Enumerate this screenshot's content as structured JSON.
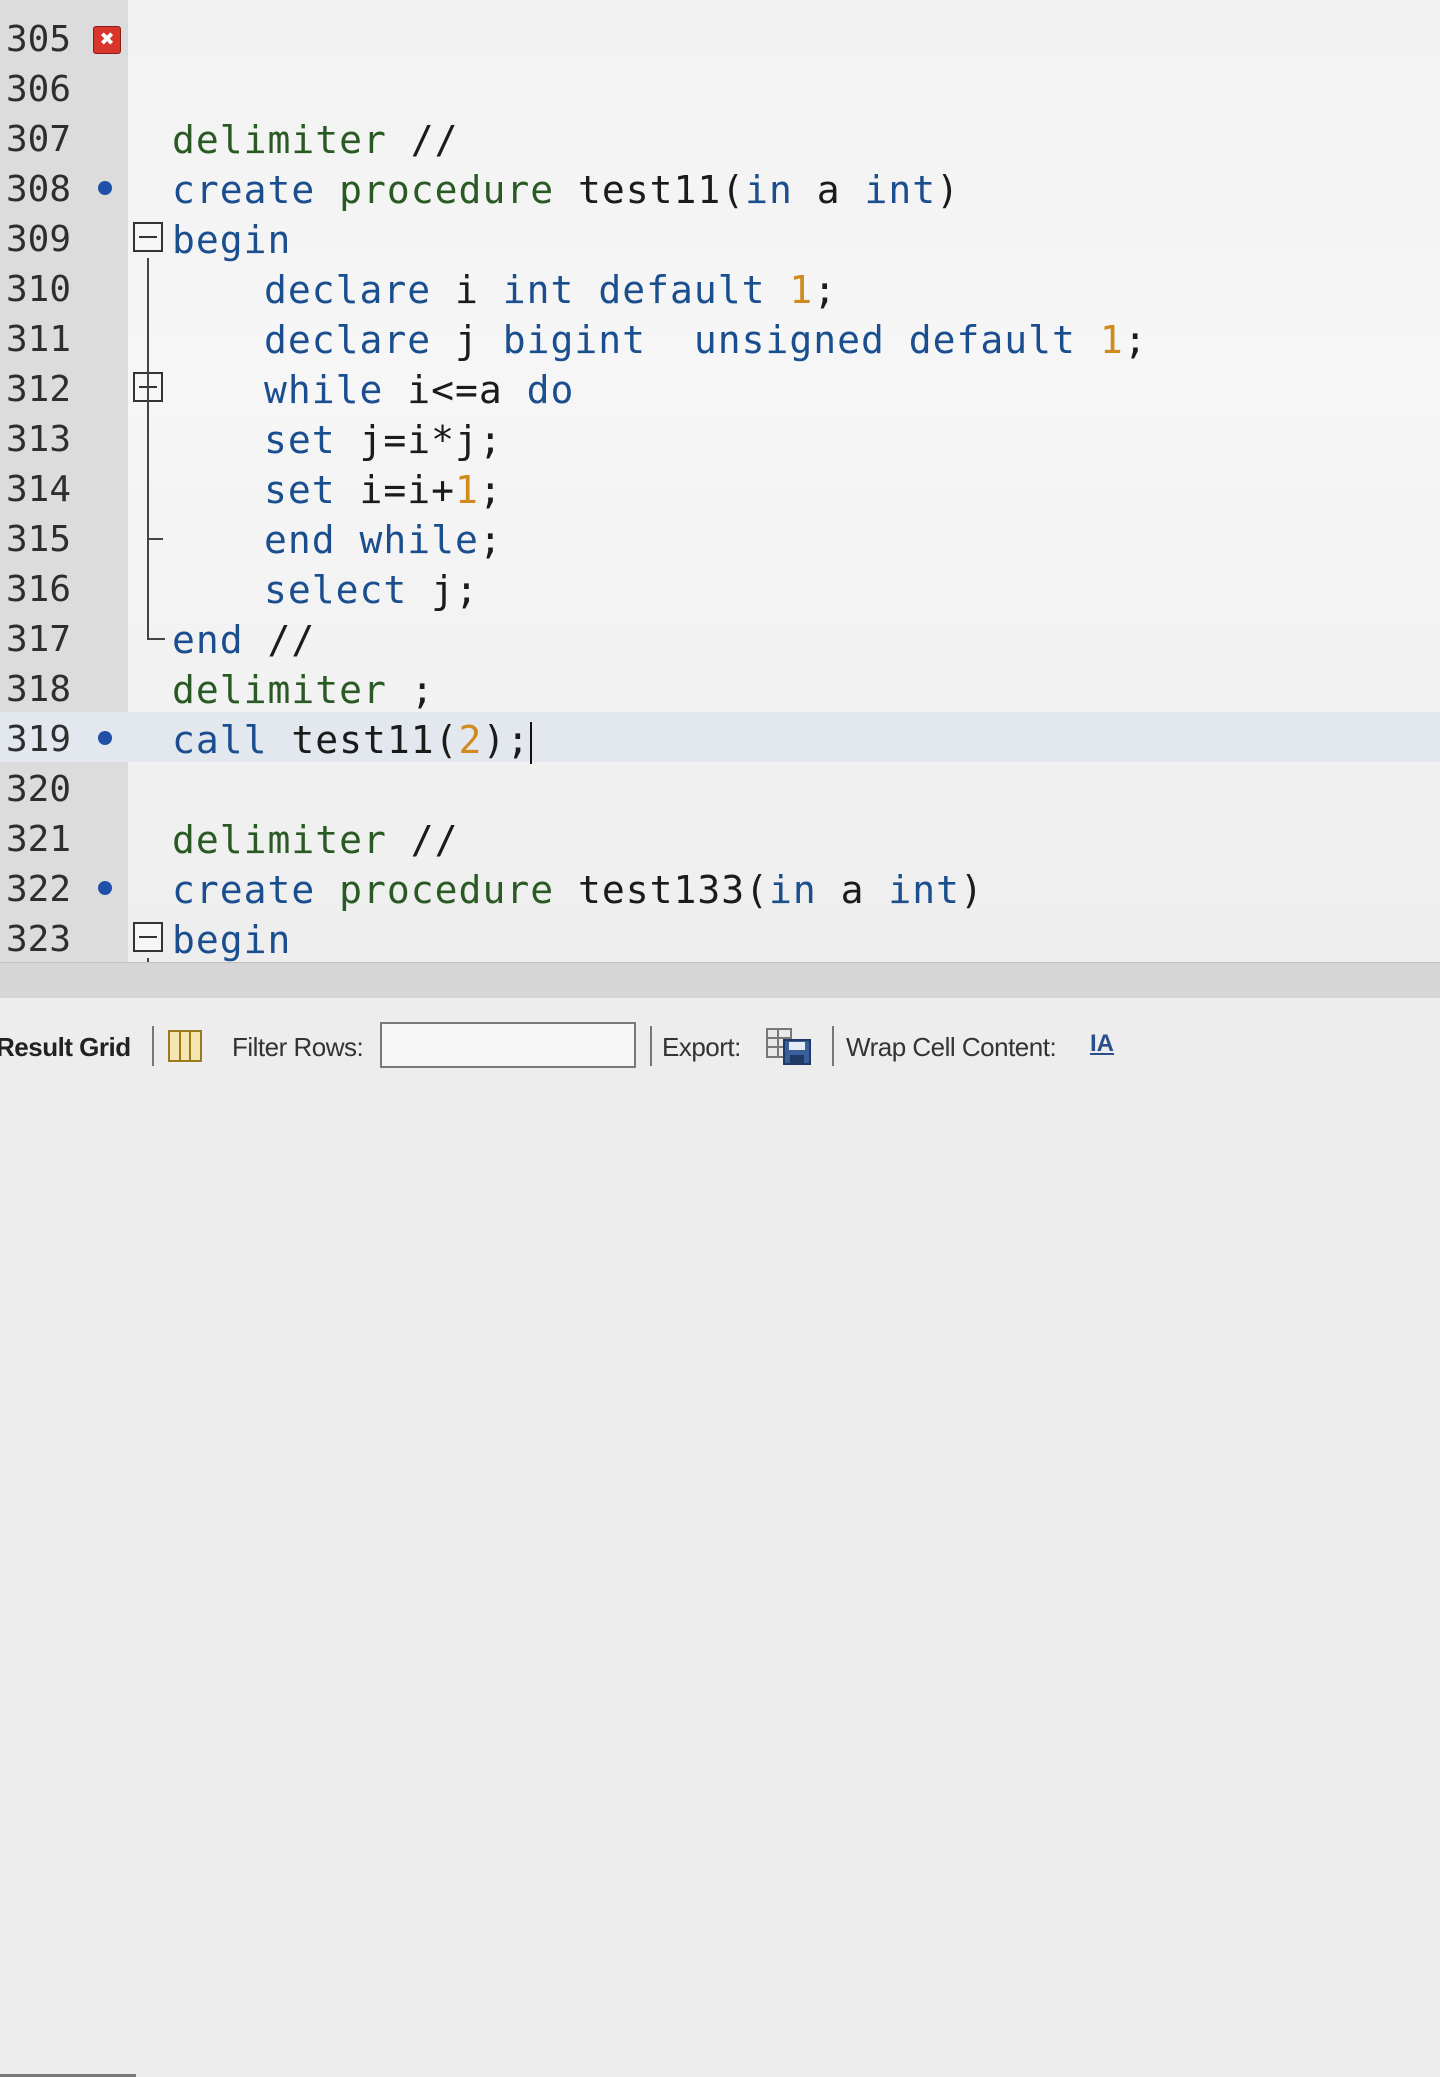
{
  "editor": {
    "lines": [
      {
        "num": "305",
        "marker": "error",
        "fold": "",
        "indent": 0,
        "tokens": []
      },
      {
        "num": "306",
        "marker": "",
        "fold": "",
        "indent": 0,
        "tokens": []
      },
      {
        "num": "307",
        "marker": "",
        "fold": "",
        "indent": 0,
        "tokens": [
          {
            "t": "delimiter",
            "c": "kw2"
          },
          {
            "t": " //",
            "c": ""
          }
        ]
      },
      {
        "num": "308",
        "marker": "dot",
        "fold": "",
        "indent": 0,
        "tokens": [
          {
            "t": "create",
            "c": "kw"
          },
          {
            "t": " ",
            "c": ""
          },
          {
            "t": "procedure",
            "c": "kw2"
          },
          {
            "t": " test11(",
            "c": ""
          },
          {
            "t": "in",
            "c": "kw"
          },
          {
            "t": " a ",
            "c": ""
          },
          {
            "t": "int",
            "c": "kw"
          },
          {
            "t": ")",
            "c": ""
          }
        ]
      },
      {
        "num": "309",
        "marker": "",
        "fold": "open",
        "indent": 0,
        "tokens": [
          {
            "t": "begin",
            "c": "kw"
          }
        ]
      },
      {
        "num": "310",
        "marker": "",
        "fold": "",
        "indent": 1,
        "tokens": [
          {
            "t": "declare",
            "c": "kw"
          },
          {
            "t": " i ",
            "c": ""
          },
          {
            "t": "int",
            "c": "kw"
          },
          {
            "t": " ",
            "c": ""
          },
          {
            "t": "default",
            "c": "kw"
          },
          {
            "t": " ",
            "c": ""
          },
          {
            "t": "1",
            "c": "num"
          },
          {
            "t": ";",
            "c": ""
          }
        ]
      },
      {
        "num": "311",
        "marker": "",
        "fold": "",
        "indent": 1,
        "tokens": [
          {
            "t": "declare",
            "c": "kw"
          },
          {
            "t": " j ",
            "c": ""
          },
          {
            "t": "bigint",
            "c": "kw"
          },
          {
            "t": "  ",
            "c": ""
          },
          {
            "t": "unsigned",
            "c": "kw"
          },
          {
            "t": " ",
            "c": ""
          },
          {
            "t": "default",
            "c": "kw"
          },
          {
            "t": " ",
            "c": ""
          },
          {
            "t": "1",
            "c": "num"
          },
          {
            "t": ";",
            "c": ""
          }
        ]
      },
      {
        "num": "312",
        "marker": "",
        "fold": "open",
        "indent": 1,
        "tokens": [
          {
            "t": "while",
            "c": "kw"
          },
          {
            "t": " i<=a ",
            "c": ""
          },
          {
            "t": "do",
            "c": "kw"
          }
        ]
      },
      {
        "num": "313",
        "marker": "",
        "fold": "",
        "indent": 1,
        "tokens": [
          {
            "t": "set",
            "c": "kw"
          },
          {
            "t": " j=i*j;",
            "c": ""
          }
        ]
      },
      {
        "num": "314",
        "marker": "",
        "fold": "",
        "indent": 1,
        "tokens": [
          {
            "t": "set",
            "c": "kw"
          },
          {
            "t": " i=i+",
            "c": ""
          },
          {
            "t": "1",
            "c": "num"
          },
          {
            "t": ";",
            "c": ""
          }
        ]
      },
      {
        "num": "315",
        "marker": "",
        "fold": "",
        "indent": 1,
        "tokens": [
          {
            "t": "end",
            "c": "kw"
          },
          {
            "t": " ",
            "c": ""
          },
          {
            "t": "while",
            "c": "kw"
          },
          {
            "t": ";",
            "c": ""
          }
        ]
      },
      {
        "num": "316",
        "marker": "",
        "fold": "",
        "indent": 1,
        "tokens": [
          {
            "t": "select",
            "c": "kw"
          },
          {
            "t": " j;",
            "c": ""
          }
        ]
      },
      {
        "num": "317",
        "marker": "",
        "fold": "",
        "indent": 0,
        "tokens": [
          {
            "t": "end",
            "c": "kw"
          },
          {
            "t": " //",
            "c": ""
          }
        ]
      },
      {
        "num": "318",
        "marker": "",
        "fold": "",
        "indent": 0,
        "tokens": [
          {
            "t": "delimiter",
            "c": "kw2"
          },
          {
            "t": " ;",
            "c": ""
          }
        ]
      },
      {
        "num": "319",
        "marker": "dot",
        "fold": "",
        "indent": 0,
        "current": true,
        "tokens": [
          {
            "t": "call",
            "c": "kw"
          },
          {
            "t": " test11(",
            "c": ""
          },
          {
            "t": "2",
            "c": "num"
          },
          {
            "t": ");",
            "c": ""
          }
        ]
      },
      {
        "num": "320",
        "marker": "",
        "fold": "",
        "indent": 0,
        "tokens": []
      },
      {
        "num": "321",
        "marker": "",
        "fold": "",
        "indent": 0,
        "tokens": [
          {
            "t": "delimiter",
            "c": "kw2"
          },
          {
            "t": " //",
            "c": ""
          }
        ]
      },
      {
        "num": "322",
        "marker": "dot",
        "fold": "",
        "indent": 0,
        "tokens": [
          {
            "t": "create",
            "c": "kw"
          },
          {
            "t": " ",
            "c": ""
          },
          {
            "t": "procedure",
            "c": "kw2"
          },
          {
            "t": " test133(",
            "c": ""
          },
          {
            "t": "in",
            "c": "kw"
          },
          {
            "t": " a ",
            "c": ""
          },
          {
            "t": "int",
            "c": "kw"
          },
          {
            "t": ")",
            "c": ""
          }
        ]
      },
      {
        "num": "323",
        "marker": "",
        "fold": "open",
        "indent": 0,
        "tokens": [
          {
            "t": "begin",
            "c": "kw"
          }
        ]
      }
    ],
    "error_marker_glyph": "✖"
  },
  "toolbar": {
    "result_grid_label": "Result Grid",
    "filter_rows_label": "Filter Rows:",
    "filter_rows_value": "",
    "export_label": "Export:",
    "wrap_label": "Wrap Cell Content:",
    "wrap_icon_glyph": "IA"
  },
  "colors": {
    "keyword": "#1a4e8e",
    "keyword_alt": "#2a5a23",
    "number": "#d08a1d",
    "error_marker": "#d9362b",
    "breakpoint_dot": "#1f4fa8"
  }
}
